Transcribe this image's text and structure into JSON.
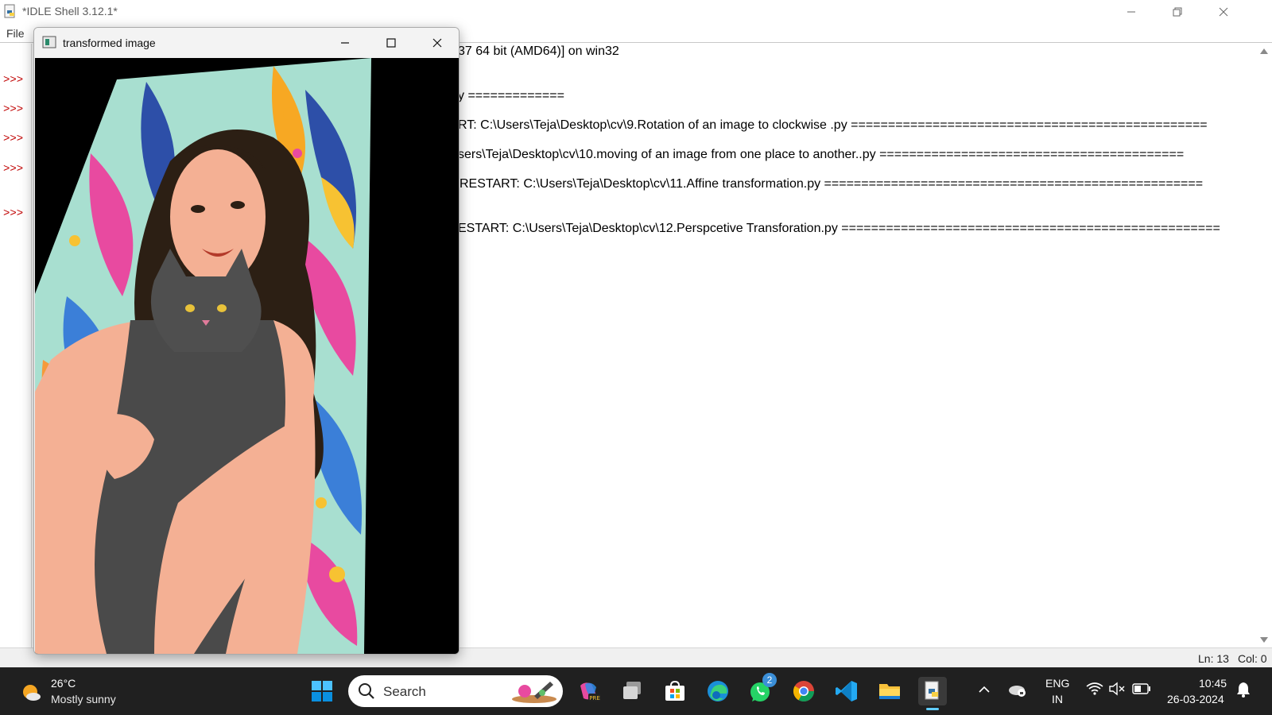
{
  "idle": {
    "title": "*IDLE Shell 3.12.1*",
    "menu": [
      "File"
    ],
    "prompt": ">>>",
    "lines": [
      "37 64 bit (AMD64)] on win32",
      "y =============",
      "RT: C:\\Users\\Teja\\Desktop\\cv\\9.Rotation of an image to clockwise .py ================================================",
      "sers\\Teja\\Desktop\\cv\\10.moving of an image from one place to another..py =========================================",
      "RESTART: C:\\Users\\Teja\\Desktop\\cv\\11.Affine transformation.py ===================================================",
      "ESTART: C:\\Users\\Teja\\Desktop\\cv\\12.Perspcetive Transforation.py ==================================================="
    ],
    "status": {
      "ln": "Ln: 13",
      "col": "Col: 0"
    }
  },
  "cv_window": {
    "title": "transformed image",
    "image_description_icon": "photo-icon"
  },
  "taskbar": {
    "weather": {
      "temp": "26°C",
      "desc": "Mostly sunny"
    },
    "search_label": "Search",
    "whatsapp_badge": "2",
    "lang": {
      "top": "ENG",
      "bottom": "IN"
    },
    "clock": {
      "time": "10:45",
      "date": "26-03-2024"
    },
    "apps": [
      "windows-start-icon",
      "search-icon",
      "copilot-pre-icon",
      "task-view-icon",
      "microsoft-store-icon",
      "edge-icon",
      "whatsapp-icon",
      "chrome-icon",
      "vscode-icon",
      "file-explorer-icon",
      "idle-python-icon"
    ]
  },
  "colors": {
    "prompt": "#c00000",
    "taskbar": "#202020",
    "accent": "#60cdff"
  }
}
